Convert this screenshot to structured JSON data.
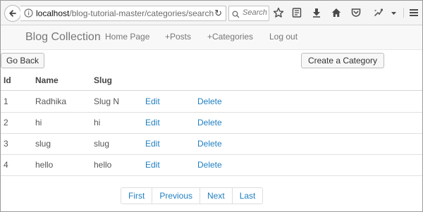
{
  "browser": {
    "url_host": "localhost",
    "url_path": "/blog-tutorial-master/categories/search",
    "search_placeholder": "Search"
  },
  "navbar": {
    "brand": "Blog Collection",
    "links": [
      "Home Page",
      "+Posts",
      "+Categories",
      "Log out"
    ]
  },
  "actions": {
    "back_label": "Go Back",
    "create_label": "Create a Category"
  },
  "table": {
    "headers": [
      "Id",
      "Name",
      "Slug"
    ],
    "rows": [
      {
        "id": "1",
        "name": "Radhika",
        "slug": "Slug N",
        "edit": "Edit",
        "delete": "Delete"
      },
      {
        "id": "2",
        "name": "hi",
        "slug": "hi",
        "edit": "Edit",
        "delete": "Delete"
      },
      {
        "id": "3",
        "name": "slug",
        "slug": "slug",
        "edit": "Edit",
        "delete": "Delete"
      },
      {
        "id": "4",
        "name": "hello",
        "slug": "hello",
        "edit": "Edit",
        "delete": "Delete"
      }
    ]
  },
  "pagination": [
    "First",
    "Previous",
    "Next",
    "Last"
  ]
}
